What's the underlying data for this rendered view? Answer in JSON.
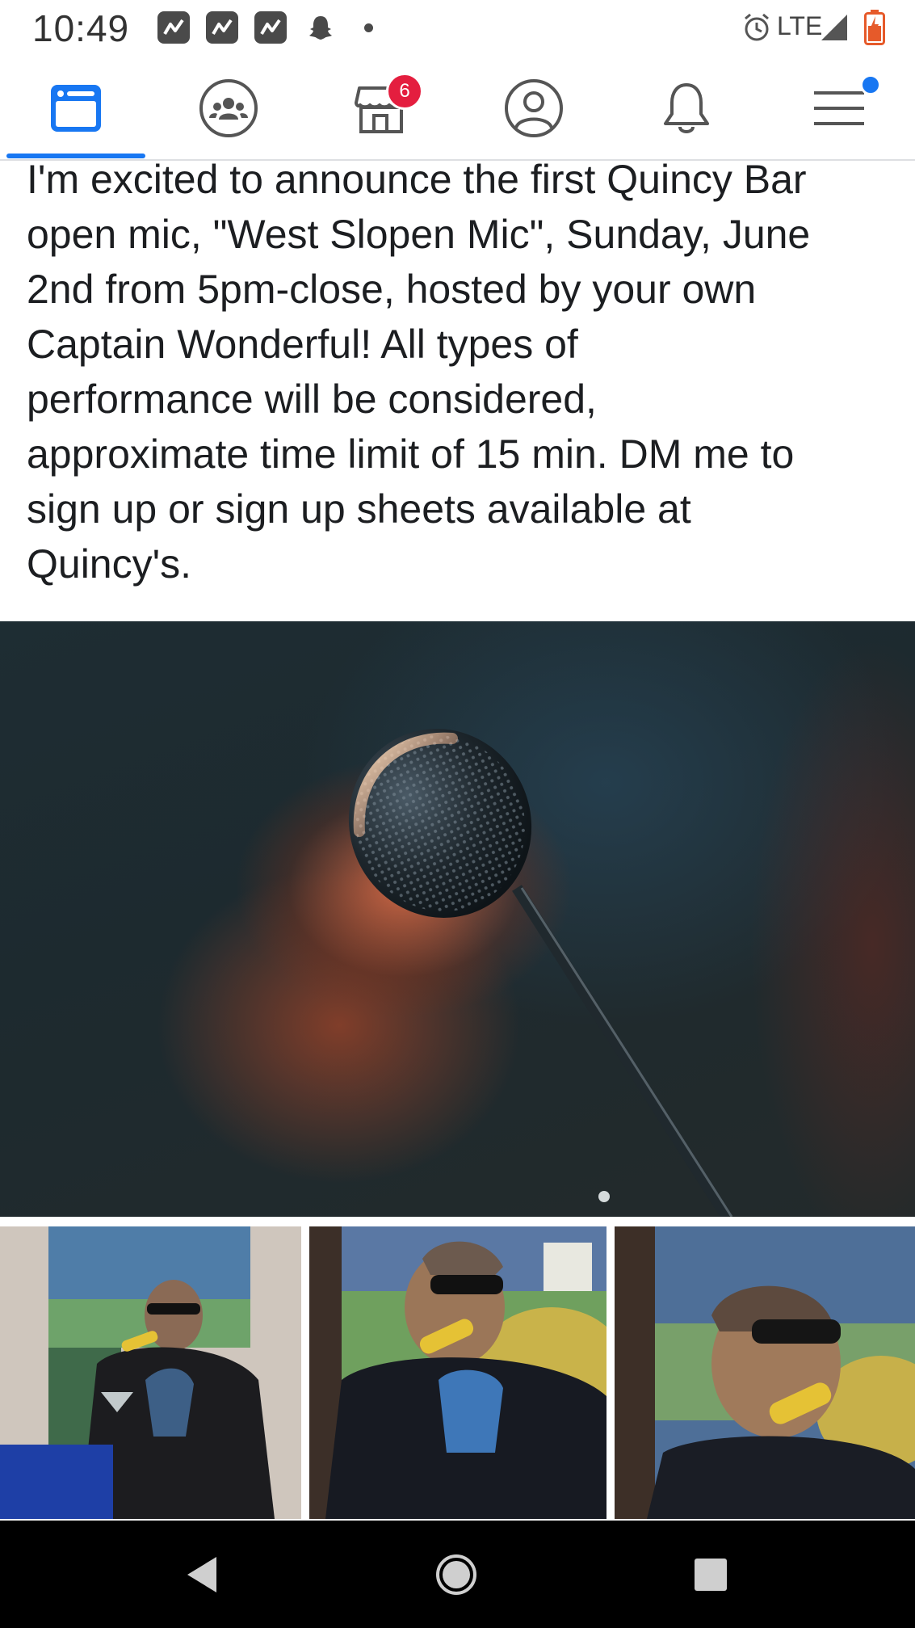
{
  "status_bar": {
    "time": "10:49",
    "network": "LTE",
    "icons": [
      "stocks-app-icon",
      "stocks-app-icon",
      "stocks-app-icon",
      "snapchat-ghost-icon",
      "more-dot-icon",
      "alarm-icon",
      "signal-icon",
      "battery-icon"
    ]
  },
  "nav": {
    "items": [
      {
        "name": "news-feed",
        "icon": "news-feed-icon",
        "active": true
      },
      {
        "name": "groups",
        "icon": "groups-icon",
        "active": false
      },
      {
        "name": "marketplace",
        "icon": "marketplace-icon",
        "active": false,
        "badge": "6"
      },
      {
        "name": "profile",
        "icon": "profile-icon",
        "active": false
      },
      {
        "name": "notifications",
        "icon": "bell-icon",
        "active": false
      },
      {
        "name": "menu",
        "icon": "hamburger-menu-icon",
        "active": false,
        "dot": true
      }
    ],
    "accent_color": "#1877f2",
    "badge_color": "#e41e3f"
  },
  "post": {
    "text_lines": [
      "I'm excited to announce the first Quincy Bar",
      "open mic, \"West Slopen Mic\", Sunday, June",
      "2nd from 5pm-close, hosted by your own",
      "Captain Wonderful! All types of",
      "performance will be considered,",
      "approximate time limit of 15 min. DM me to",
      "sign up or sign up sheets available at",
      "Quincy's."
    ],
    "photos": {
      "main": "microphone-photo",
      "thumbnails": [
        "man-with-martini-photo",
        "man-with-banana-phone-photo",
        "man-with-banana-phone-closeup-photo"
      ]
    }
  },
  "system_nav": {
    "buttons": [
      "back-button",
      "home-button",
      "recents-button"
    ]
  }
}
